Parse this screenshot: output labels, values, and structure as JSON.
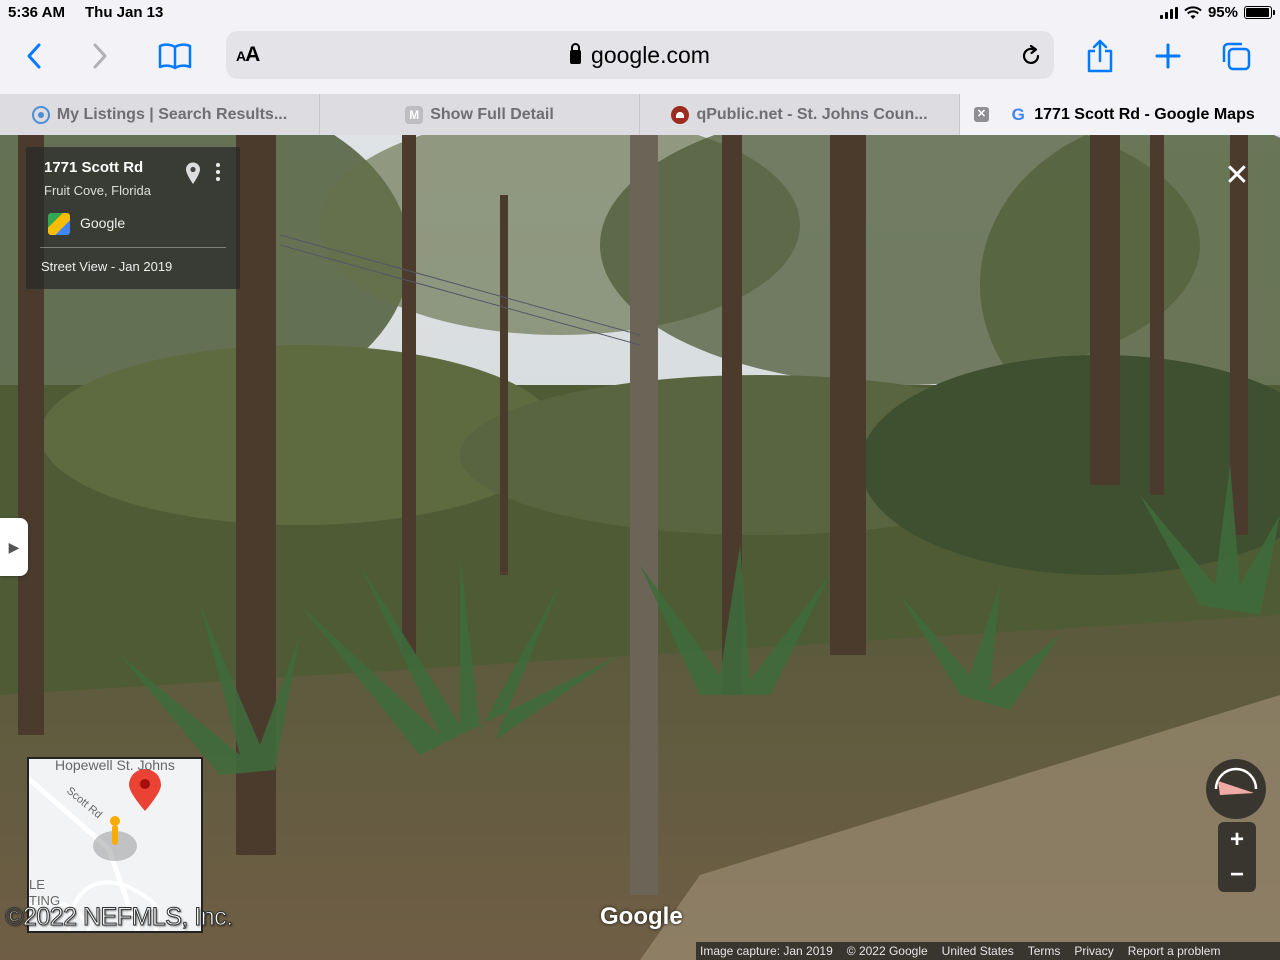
{
  "status_bar": {
    "time": "5:36 AM",
    "date": "Thu Jan 13",
    "battery": "95%",
    "battery_level": 0.95
  },
  "toolbar": {
    "text_size_label": "AA",
    "host": "google.com",
    "icons": [
      "back-icon",
      "forward-icon",
      "bookmarks-icon",
      "lock-icon",
      "reload-icon",
      "share-icon",
      "new-tab-icon",
      "tabs-icon"
    ]
  },
  "tabs": [
    {
      "label": "My Listings | Search Results...",
      "favicon": "listings-favicon"
    },
    {
      "label": "Show Full Detail",
      "favicon": "m-favicon",
      "favicon_text": "M"
    },
    {
      "label": "qPublic.net - St. Johns Coun...",
      "favicon": "qpublic-favicon"
    },
    {
      "label": "1771 Scott Rd - Google Maps",
      "favicon": "google-favicon",
      "favicon_text": "G",
      "active": true
    }
  ],
  "street_view": {
    "address": "1771 Scott Rd",
    "locality": "Fruit Cove, Florida",
    "source": "Google",
    "capture_label": "Street View - Jan 2019",
    "minimap": {
      "area_label": "Hopewell St. Johns",
      "road_label": "Scott Rd",
      "edge_label_1": "LE",
      "edge_label_2": "TING"
    },
    "zoom_in": "+",
    "zoom_out": "−",
    "watermark": "©2022 NEFMLS, Inc.",
    "google_watermark": "Google",
    "footer": {
      "capture": "Image capture: Jan 2019",
      "copyright": "© 2022 Google",
      "country": "United States",
      "terms": "Terms",
      "privacy": "Privacy",
      "report": "Report a problem"
    }
  },
  "colors": {
    "ios_blue": "#007aff",
    "map_pin": "#ea4335",
    "pegman": "#f9ab00"
  }
}
